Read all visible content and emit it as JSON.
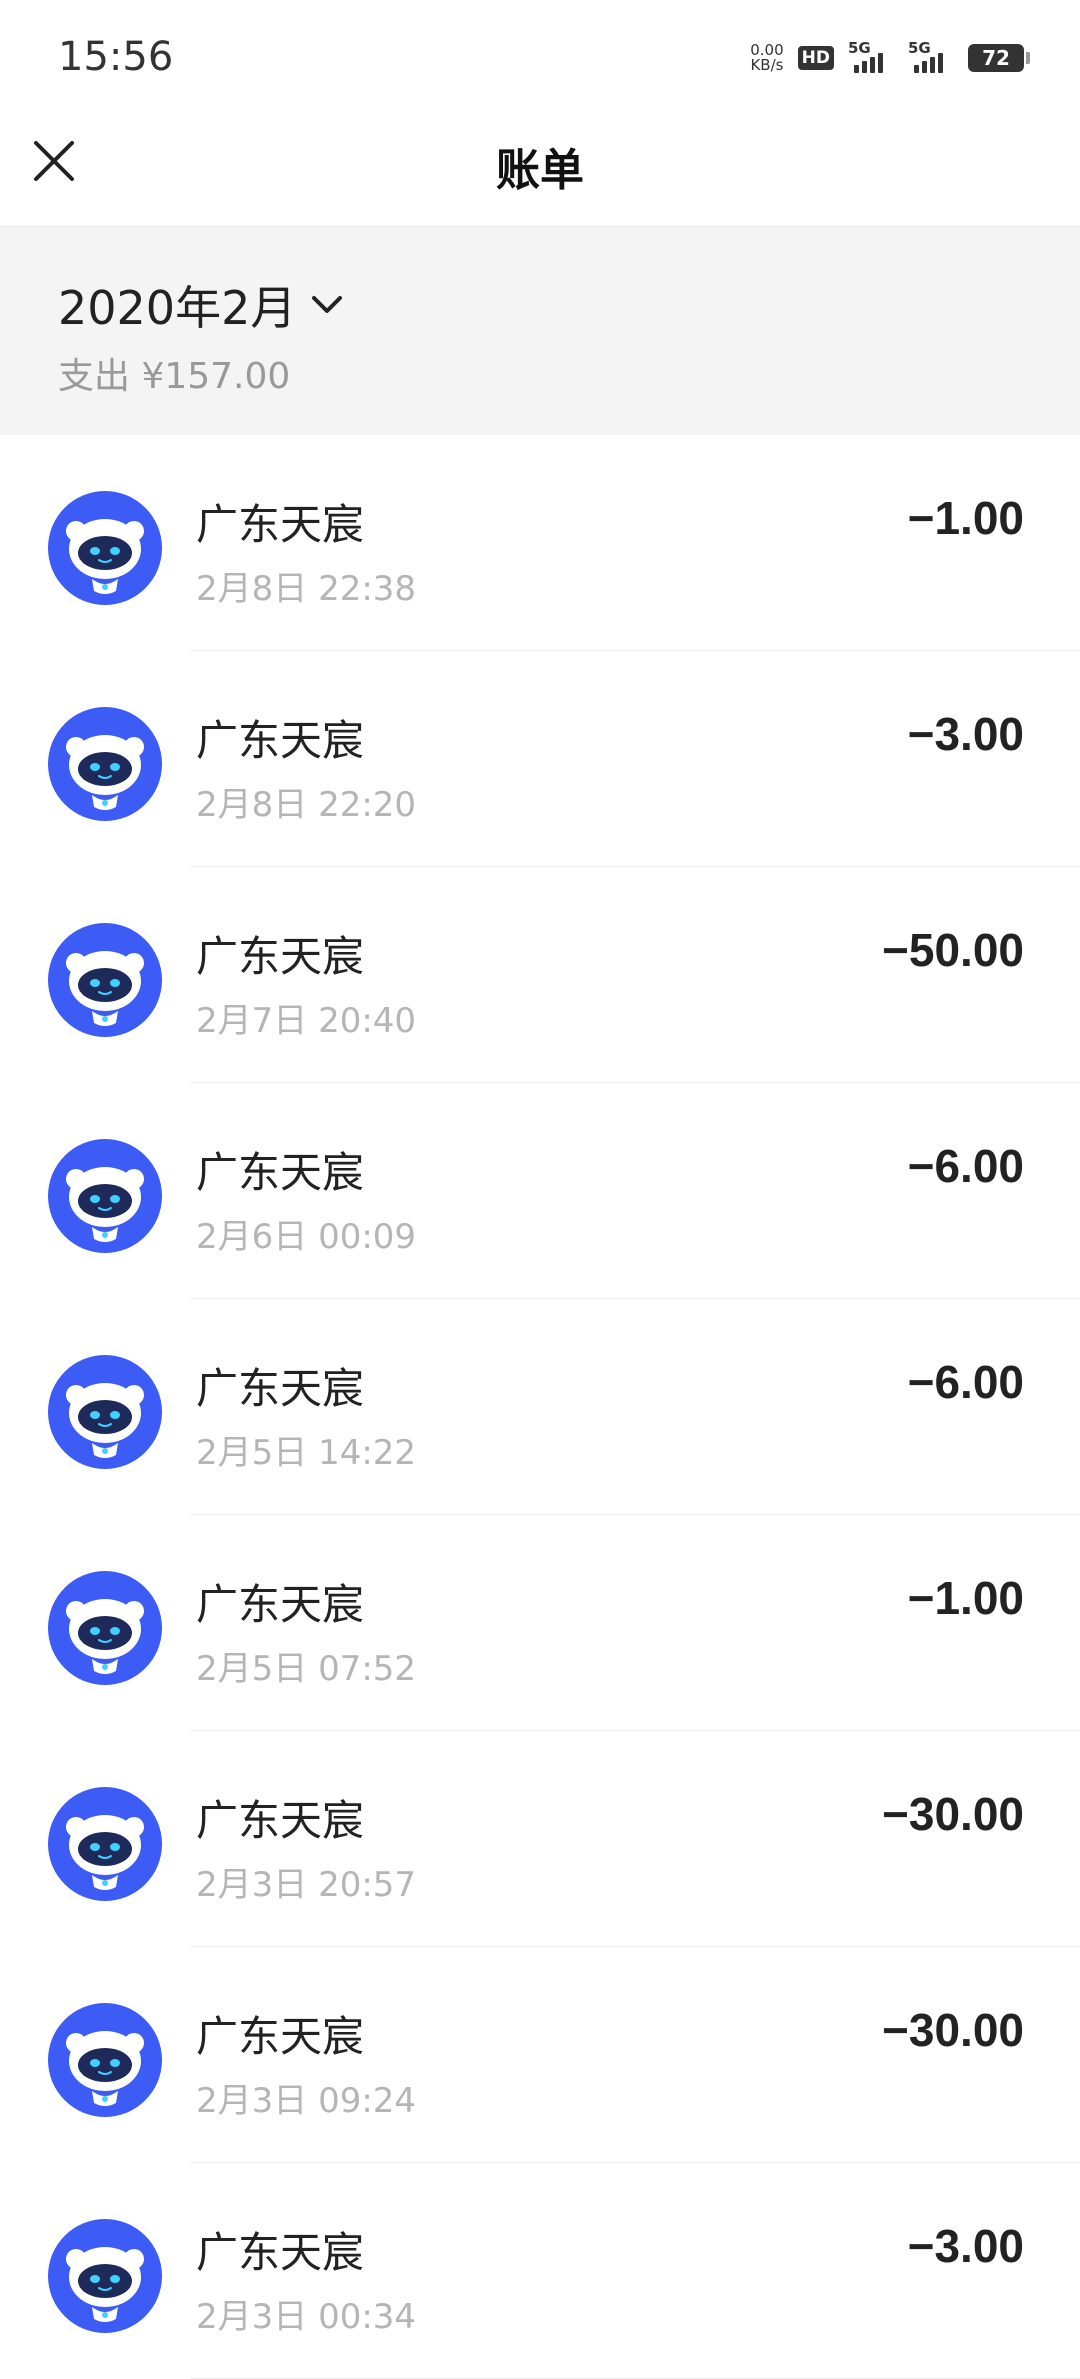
{
  "status_bar": {
    "time": "15:56",
    "net_speed_value": "0.00",
    "net_speed_unit": "KB/s",
    "hd_label": "HD",
    "signal1_label": "5G",
    "signal2_label": "5G",
    "battery": "72"
  },
  "nav": {
    "title": "账单",
    "close_icon": "close-icon"
  },
  "summary": {
    "month": "2020年2月",
    "expense": "支出 ¥157.00"
  },
  "transactions": [
    {
      "merchant": "广东天宸",
      "datetime": "2月8日 22:38",
      "amount": "−1.00"
    },
    {
      "merchant": "广东天宸",
      "datetime": "2月8日 22:20",
      "amount": "−3.00"
    },
    {
      "merchant": "广东天宸",
      "datetime": "2月7日 20:40",
      "amount": "−50.00"
    },
    {
      "merchant": "广东天宸",
      "datetime": "2月6日 00:09",
      "amount": "−6.00"
    },
    {
      "merchant": "广东天宸",
      "datetime": "2月5日 14:22",
      "amount": "−6.00"
    },
    {
      "merchant": "广东天宸",
      "datetime": "2月5日 07:52",
      "amount": "−1.00"
    },
    {
      "merchant": "广东天宸",
      "datetime": "2月3日 20:57",
      "amount": "−30.00"
    },
    {
      "merchant": "广东天宸",
      "datetime": "2月3日 09:24",
      "amount": "−30.00"
    },
    {
      "merchant": "广东天宸",
      "datetime": "2月3日 00:34",
      "amount": "−3.00"
    }
  ],
  "colors": {
    "avatar_blue": "#3d5cf5",
    "robot_visor": "#1e2a5a",
    "robot_eyes": "#3fd0ff"
  }
}
